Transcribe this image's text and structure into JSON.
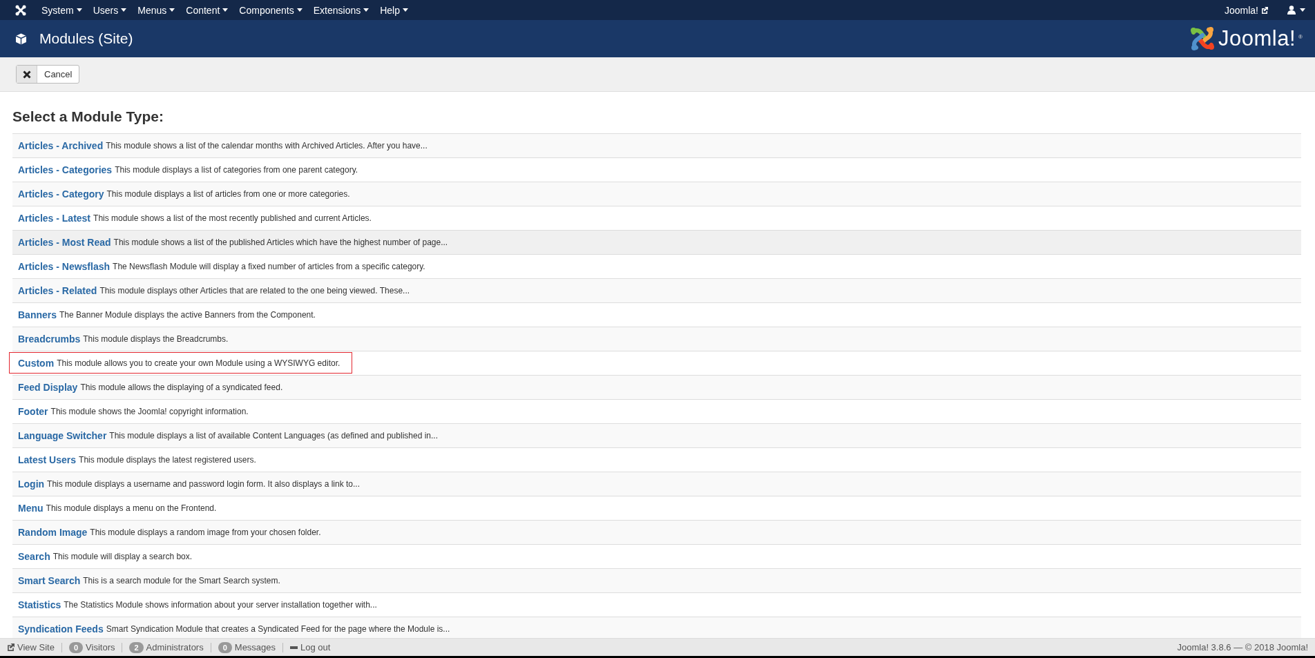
{
  "menu": [
    "System",
    "Users",
    "Menus",
    "Content",
    "Components",
    "Extensions",
    "Help"
  ],
  "site_link": "Joomla!",
  "header": {
    "title": "Modules (Site)",
    "logo_text": "Joomla!",
    "logo_mark": "®"
  },
  "toolbar": {
    "cancel": "Cancel"
  },
  "heading": "Select a Module Type:",
  "modules": [
    {
      "name": "Articles - Archived",
      "description": "This module shows a list of the calendar months with Archived Articles. After you have...",
      "highlighted": false,
      "marked": false
    },
    {
      "name": "Articles - Categories",
      "description": "This module displays a list of categories from one parent category.",
      "highlighted": false,
      "marked": false
    },
    {
      "name": "Articles - Category",
      "description": "This module displays a list of articles from one or more categories.",
      "highlighted": false,
      "marked": false
    },
    {
      "name": "Articles - Latest",
      "description": "This module shows a list of the most recently published and current Articles.",
      "highlighted": false,
      "marked": false
    },
    {
      "name": "Articles - Most Read",
      "description": "This module shows a list of the published Articles which have the highest number of page...",
      "highlighted": true,
      "marked": false
    },
    {
      "name": "Articles - Newsflash",
      "description": "The Newsflash Module will display a fixed number of articles from a specific category.",
      "highlighted": false,
      "marked": false
    },
    {
      "name": "Articles - Related",
      "description": "This module displays other Articles that are related to the one being viewed. These...",
      "highlighted": false,
      "marked": false
    },
    {
      "name": "Banners",
      "description": "The Banner Module displays the active Banners from the Component.",
      "highlighted": false,
      "marked": false
    },
    {
      "name": "Breadcrumbs",
      "description": "This module displays the Breadcrumbs.",
      "highlighted": false,
      "marked": false
    },
    {
      "name": "Custom",
      "description": "This module allows you to create your own Module using a WYSIWYG editor.",
      "highlighted": false,
      "marked": true
    },
    {
      "name": "Feed Display",
      "description": "This module allows the displaying of a syndicated feed.",
      "highlighted": false,
      "marked": false
    },
    {
      "name": "Footer",
      "description": "This module shows the Joomla! copyright information.",
      "highlighted": false,
      "marked": false
    },
    {
      "name": "Language Switcher",
      "description": "This module displays a list of available Content Languages (as defined and published in...",
      "highlighted": false,
      "marked": false
    },
    {
      "name": "Latest Users",
      "description": "This module displays the latest registered users.",
      "highlighted": false,
      "marked": false
    },
    {
      "name": "Login",
      "description": "This module displays a username and password login form. It also displays a link to...",
      "highlighted": false,
      "marked": false
    },
    {
      "name": "Menu",
      "description": "This module displays a menu on the Frontend.",
      "highlighted": false,
      "marked": false
    },
    {
      "name": "Random Image",
      "description": "This module displays a random image from your chosen folder.",
      "highlighted": false,
      "marked": false
    },
    {
      "name": "Search",
      "description": "This module will display a search box.",
      "highlighted": false,
      "marked": false
    },
    {
      "name": "Smart Search",
      "description": "This is a search module for the Smart Search system.",
      "highlighted": false,
      "marked": false
    },
    {
      "name": "Statistics",
      "description": "The Statistics Module shows information about your server installation together with...",
      "highlighted": false,
      "marked": false
    },
    {
      "name": "Syndication Feeds",
      "description": "Smart Syndication Module that creates a Syndicated Feed for the page where the Module is...",
      "highlighted": false,
      "marked": false
    }
  ],
  "status_bar": {
    "view_site": "View Site",
    "counters": [
      {
        "count": "0",
        "label": "Visitors"
      },
      {
        "count": "2",
        "label": "Administrators"
      },
      {
        "count": "0",
        "label": "Messages"
      }
    ],
    "logout": "Log out",
    "version": "Joomla! 3.8.6  —  © 2018 Joomla!"
  }
}
